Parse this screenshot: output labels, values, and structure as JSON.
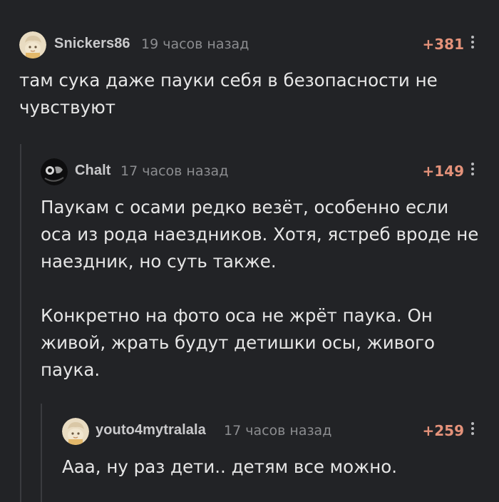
{
  "comments": [
    {
      "username": "Snickers86",
      "time": "19 часов назад",
      "rating": "+381",
      "avatar": "cartoon-avatar-icon",
      "text": [
        "там сука даже пауки себя в безопасности не чувствуют"
      ]
    },
    {
      "username": "Chalt",
      "time": "17 часов назад",
      "rating": "+149",
      "avatar": "dark-photo-avatar",
      "text": [
        "Паукам с осами редко везёт, особенно если оса из рода наездников. Хотя, ястреб вроде не наездник, но суть также.",
        "Конкретно на фото оса не жрёт паука. Он живой, жрать будут детишки осы, живого паука."
      ]
    },
    {
      "username": "youto4mytralala",
      "time": "17 часов назад",
      "rating": "+259",
      "avatar": "cartoon-avatar-icon",
      "text": [
        "Ааа, ну раз дети.. детям все можно."
      ]
    }
  ],
  "colors": {
    "background": "#222326",
    "rating": "#e4927a",
    "username": "#c9c9cb",
    "time": "#8c8d90",
    "thread_line": "#3a3b3f"
  }
}
